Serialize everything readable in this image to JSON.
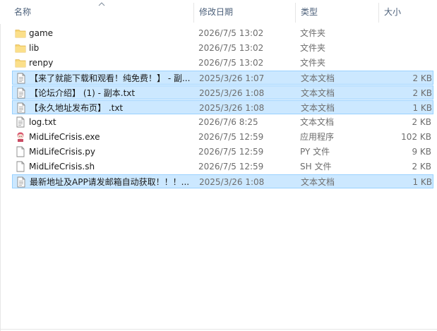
{
  "columns": {
    "name": "名称",
    "date": "修改日期",
    "type": "类型",
    "size": "大小"
  },
  "files": [
    {
      "name": "game",
      "date": "2026/7/5 13:02",
      "type": "文件夹",
      "size": "",
      "icon": "folder-icon",
      "selected": false
    },
    {
      "name": "lib",
      "date": "2026/7/5 13:02",
      "type": "文件夹",
      "size": "",
      "icon": "folder-icon",
      "selected": false
    },
    {
      "name": "renpy",
      "date": "2026/7/5 13:02",
      "type": "文件夹",
      "size": "",
      "icon": "folder-icon",
      "selected": false
    },
    {
      "name": "【来了就能下载和观看！纯免费！】 - 副...",
      "date": "2025/3/26 1:07",
      "type": "文本文档",
      "size": "2 KB",
      "icon": "text-file-icon",
      "selected": true
    },
    {
      "name": "【论坛介绍】 (1) - 副本.txt",
      "date": "2025/3/26 1:08",
      "type": "文本文档",
      "size": "2 KB",
      "icon": "text-file-icon",
      "selected": true
    },
    {
      "name": "【永久地址发布页】 .txt",
      "date": "2025/3/26 1:08",
      "type": "文本文档",
      "size": "1 KB",
      "icon": "text-file-icon",
      "selected": true
    },
    {
      "name": "log.txt",
      "date": "2026/7/6 8:25",
      "type": "文本文档",
      "size": "2 KB",
      "icon": "text-file-icon",
      "selected": false
    },
    {
      "name": "MidLifeCrisis.exe",
      "date": "2026/7/5 12:59",
      "type": "应用程序",
      "size": "102 KB",
      "icon": "app-exe-icon",
      "selected": false
    },
    {
      "name": "MidLifeCrisis.py",
      "date": "2026/7/5 12:59",
      "type": "PY 文件",
      "size": "9 KB",
      "icon": "blank-file-icon",
      "selected": false
    },
    {
      "name": "MidLifeCrisis.sh",
      "date": "2026/7/5 12:59",
      "type": "SH 文件",
      "size": "2 KB",
      "icon": "blank-file-icon",
      "selected": false
    },
    {
      "name": "最新地址及APP请发邮箱自动获取！！！...",
      "date": "2025/3/26 1:08",
      "type": "文本文档",
      "size": "1 KB",
      "icon": "text-file-icon",
      "selected": true
    }
  ],
  "colors": {
    "selection_bg": "#cce8ff",
    "selection_border": "#99d1ff",
    "header_text": "#4c607a",
    "folder": "#f8d775"
  }
}
